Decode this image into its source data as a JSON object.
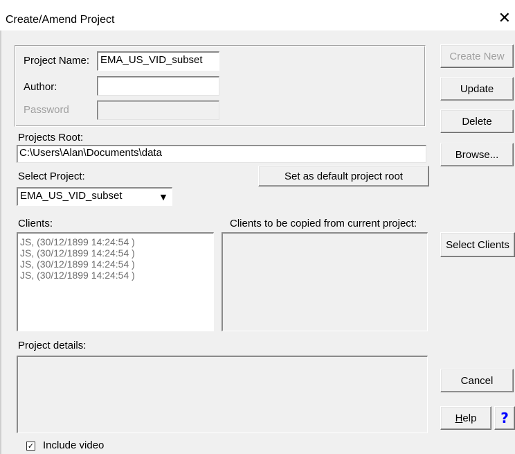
{
  "window": {
    "title": "Create/Amend Project",
    "close_glyph": "✕"
  },
  "project": {
    "name_label": "Project Name:",
    "name_value": "EMA_US_VID_subset",
    "author_label": "Author:",
    "author_value": "",
    "password_label": "Password",
    "password_value": ""
  },
  "root": {
    "label": "Projects Root:",
    "value": "C:\\Users\\Alan\\Documents\\data",
    "set_default_label": "Set as default project root"
  },
  "select_project": {
    "label": "Select Project:",
    "selected": "EMA_US_VID_subset",
    "arrow_glyph": "▼"
  },
  "clients": {
    "label": "Clients:",
    "items": [
      "JS,  (30/12/1899 14:24:54  )",
      "JS,  (30/12/1899 14:24:54  )",
      "JS,  (30/12/1899 14:24:54  )",
      "JS,  (30/12/1899 14:24:54  )"
    ],
    "copy_label": "Clients to be copied from current project:"
  },
  "details": {
    "label": "Project details:"
  },
  "include_video": {
    "label": "Include video",
    "checked": true,
    "check_glyph": "✓"
  },
  "buttons": {
    "create_new": "Create New",
    "update": "Update",
    "delete": "Delete",
    "browse": "Browse...",
    "select_clients": "Select Clients",
    "cancel": "Cancel",
    "help_first": "H",
    "help_rest": "elp",
    "help_icon": "?"
  },
  "icons": {
    "close": "close-icon",
    "dropdown": "chevron-down-icon",
    "help": "question-mark-icon",
    "checkbox": "checkmark-icon"
  }
}
